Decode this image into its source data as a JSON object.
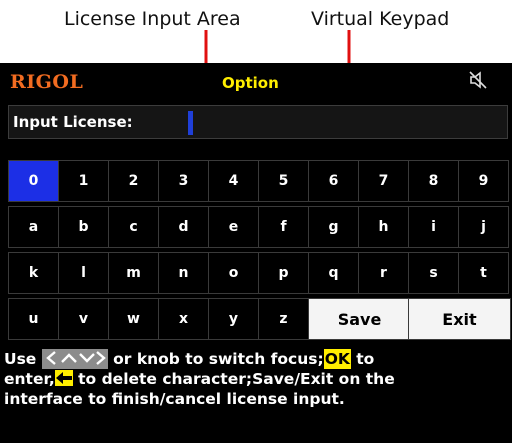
{
  "callouts": {
    "license_input_area": "License Input Area",
    "virtual_keypad": "Virtual Keypad"
  },
  "header": {
    "brand": "RIGOL",
    "title": "Option",
    "status_icon": "mute-icon"
  },
  "input": {
    "label": "Input License:",
    "value": ""
  },
  "keypad": {
    "rows": [
      [
        "0",
        "1",
        "2",
        "3",
        "4",
        "5",
        "6",
        "7",
        "8",
        "9"
      ],
      [
        "a",
        "b",
        "c",
        "d",
        "e",
        "f",
        "g",
        "h",
        "i",
        "j"
      ],
      [
        "k",
        "l",
        "m",
        "n",
        "o",
        "p",
        "q",
        "r",
        "s",
        "t"
      ],
      [
        "u",
        "v",
        "w",
        "x",
        "y",
        "z"
      ]
    ],
    "selected": "0",
    "save_label": "Save",
    "exit_label": "Exit"
  },
  "help": {
    "text_use": "Use",
    "text_switch": " or knob to switch focus;",
    "ok_label": "OK",
    "text_to": " to",
    "text_enter": "enter,",
    "text_delete": " to delete character;Save/Exit on the",
    "text_finish": "interface to finish/cancel license input."
  },
  "colors": {
    "brand": "#f26c21",
    "title": "#ffee00",
    "selection": "#1c2fe6",
    "cursor": "#1f3fd8",
    "arrow": "#e01010"
  }
}
